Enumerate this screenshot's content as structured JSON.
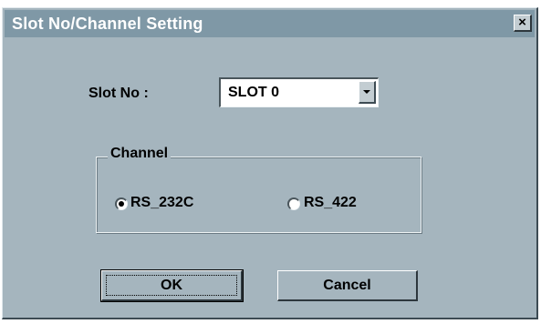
{
  "window": {
    "title": "Slot No/Channel Setting",
    "close_glyph": "×"
  },
  "slot": {
    "label": "Slot No :",
    "selected": "SLOT 0"
  },
  "channel": {
    "legend": "Channel",
    "options": [
      {
        "label": "RS_232C",
        "selected": true
      },
      {
        "label": "RS_422",
        "selected": false
      }
    ]
  },
  "buttons": {
    "ok": "OK",
    "cancel": "Cancel"
  },
  "icons": {
    "close": "close-icon",
    "dropdown": "chevron-down-icon"
  }
}
